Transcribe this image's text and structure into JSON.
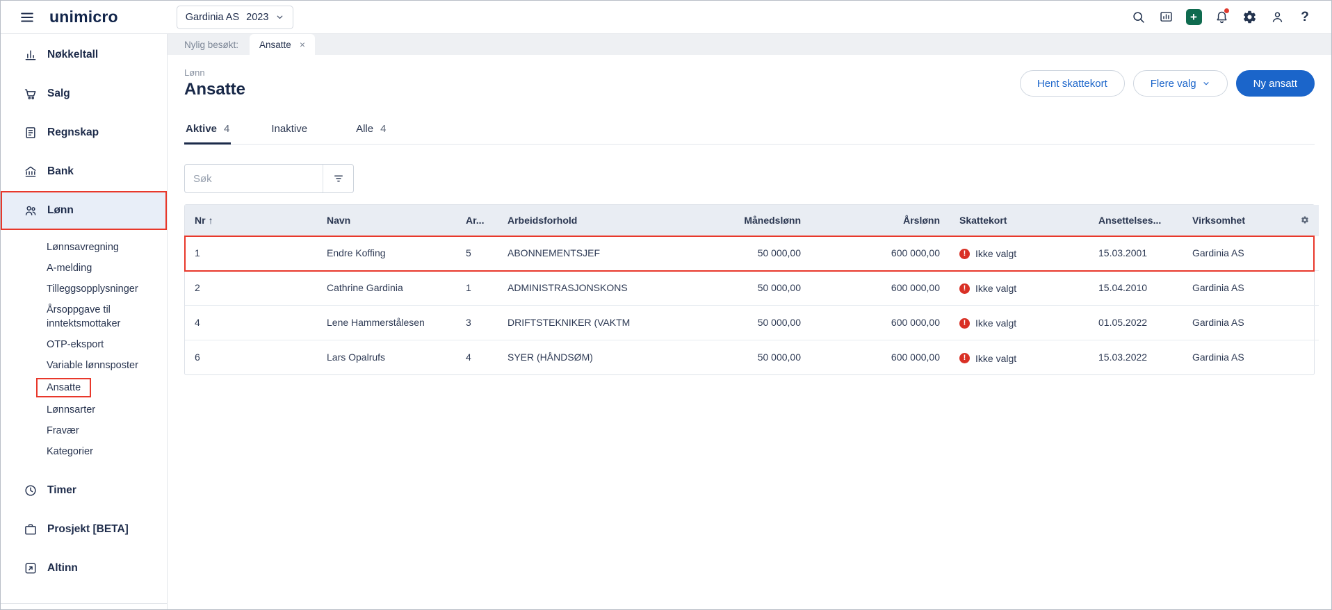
{
  "header": {
    "logo": "unimicro",
    "company": "Gardinia AS",
    "year": "2023"
  },
  "sidebar": {
    "items": [
      {
        "label": "Nøkkeltall"
      },
      {
        "label": "Salg"
      },
      {
        "label": "Regnskap"
      },
      {
        "label": "Bank"
      },
      {
        "label": "Lønn"
      },
      {
        "label": "Timer"
      },
      {
        "label": "Prosjekt [BETA]"
      },
      {
        "label": "Altinn"
      }
    ],
    "lonn_submenu": [
      {
        "label": "Lønnsavregning"
      },
      {
        "label": "A-melding"
      },
      {
        "label": "Tilleggsopplysninger"
      },
      {
        "label": "Årsoppgave til inntektsmottaker"
      },
      {
        "label": "OTP-eksport"
      },
      {
        "label": "Variable lønnsposter"
      },
      {
        "label": "Ansatte"
      },
      {
        "label": "Lønnsarter"
      },
      {
        "label": "Fravær"
      },
      {
        "label": "Kategorier"
      }
    ]
  },
  "tabstrip": {
    "recent_label": "Nylig besøkt:",
    "active_tab": "Ansatte"
  },
  "page": {
    "eyebrow": "Lønn",
    "title": "Ansatte",
    "buttons": {
      "hent_skattekort": "Hent skattekort",
      "flere_valg": "Flere valg",
      "ny_ansatt": "Ny ansatt"
    }
  },
  "filter_tabs": [
    {
      "label": "Aktive",
      "count": "4"
    },
    {
      "label": "Inaktive",
      "count": ""
    },
    {
      "label": "Alle",
      "count": "4"
    }
  ],
  "search": {
    "placeholder": "Søk"
  },
  "table": {
    "columns": {
      "nr": "Nr",
      "navn": "Navn",
      "ar": "Ar...",
      "arbeidsforhold": "Arbeidsforhold",
      "manedslonn": "Månedslønn",
      "arslonn": "Årslønn",
      "skattekort": "Skattekort",
      "ansettelses": "Ansettelses...",
      "virksomhet": "Virksomhet"
    },
    "rows": [
      {
        "nr": "1",
        "navn": "Endre Koffing",
        "ar": "5",
        "arbeidsforhold": "ABONNEMENTSJEF",
        "manedslonn": "50 000,00",
        "arslonn": "600 000,00",
        "skattekort": "Ikke valgt",
        "ansettelses": "15.03.2001",
        "virksomhet": "Gardinia AS"
      },
      {
        "nr": "2",
        "navn": "Cathrine Gardinia",
        "ar": "1",
        "arbeidsforhold": "ADMINISTRASJONSKONS",
        "manedslonn": "50 000,00",
        "arslonn": "600 000,00",
        "skattekort": "Ikke valgt",
        "ansettelses": "15.04.2010",
        "virksomhet": "Gardinia AS"
      },
      {
        "nr": "4",
        "navn": "Lene Hammerstålesen",
        "ar": "3",
        "arbeidsforhold": "DRIFTSTEKNIKER (VAKTM",
        "manedslonn": "50 000,00",
        "arslonn": "600 000,00",
        "skattekort": "Ikke valgt",
        "ansettelses": "01.05.2022",
        "virksomhet": "Gardinia AS"
      },
      {
        "nr": "6",
        "navn": "Lars Opalrufs",
        "ar": "4",
        "arbeidsforhold": "SYER (HÅNDSØM)",
        "manedslonn": "50 000,00",
        "arslonn": "600 000,00",
        "skattekort": "Ikke valgt",
        "ansettelses": "15.03.2022",
        "virksomhet": "Gardinia AS"
      }
    ]
  },
  "glyphs": {
    "sort_up": "↑",
    "close": "×",
    "help": "?",
    "plus": "+",
    "exclaim": "!"
  },
  "colors": {
    "primary_blue": "#1b65ca",
    "navy": "#1d2b4a",
    "annotation_red": "#e8382b",
    "error_red": "#d93025",
    "plus_green": "#0f6b4f",
    "table_header_bg": "#e9edf3"
  }
}
